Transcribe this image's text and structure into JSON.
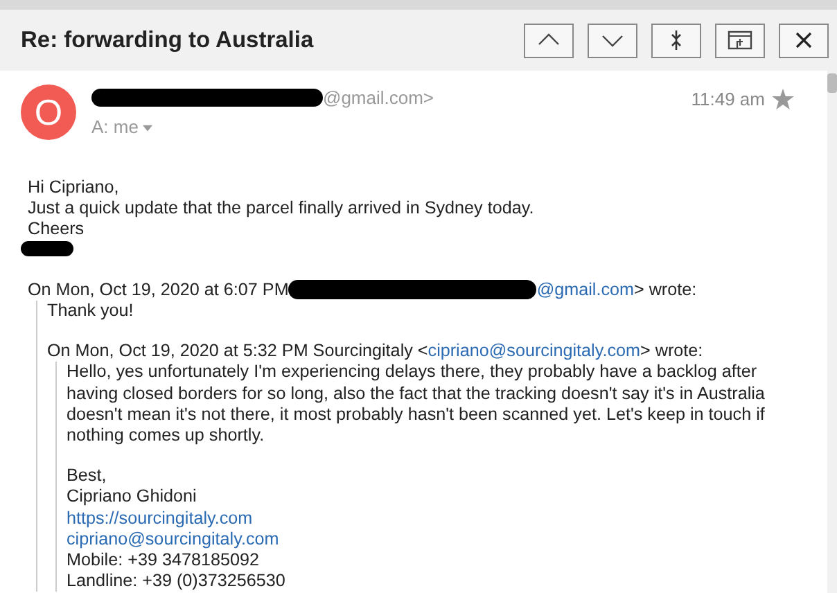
{
  "header": {
    "subject": "Re: forwarding to Australia",
    "buttons": [
      {
        "kind": "up"
      },
      {
        "kind": "down"
      },
      {
        "kind": "expand"
      },
      {
        "kind": "popout"
      },
      {
        "kind": "close"
      }
    ]
  },
  "message": {
    "avatar_letter": "O",
    "sender_tail": "@gmail.com>",
    "time": "11:49 am",
    "starred": false,
    "recipient": "A: me",
    "body": [
      "Hi Cipriano,",
      "Just a quick update that the parcel finally arrived in Sydney today.",
      "Cheers"
    ],
    "quote": {
      "intro_start": "On Mon, Oct 19, 2020 at 6:07 PM",
      "intro_link": "@gmail.com",
      "intro_end": "> wrote:",
      "body": [
        "Thank you!"
      ],
      "quote": {
        "intro_start": "On Mon, Oct 19, 2020 at 5:32 PM Sourcingitaly <",
        "intro_link": "cipriano@sourcingitaly.com",
        "intro_end": "> wrote:",
        "paragraph": "Hello, yes unfortunately I'm experiencing delays there, they probably have a backlog after having closed borders for so long, also the fact that the tracking doesn't say it's in Australia doesn't mean it's not there, it most probably hasn't been scanned yet. Let's keep in touch if nothing comes up shortly.",
        "signature": [
          {
            "kind": "text",
            "text": "Best,"
          },
          {
            "kind": "text",
            "text": "Cipriano Ghidoni"
          },
          {
            "kind": "link",
            "text": "https://sourcingitaly.com"
          },
          {
            "kind": "link",
            "text": "cipriano@sourcingitaly.com"
          },
          {
            "kind": "text",
            "text": "Mobile: +39 3478185092"
          },
          {
            "kind": "text",
            "text": "Landline: +39 (0)373256530"
          }
        ]
      }
    }
  }
}
